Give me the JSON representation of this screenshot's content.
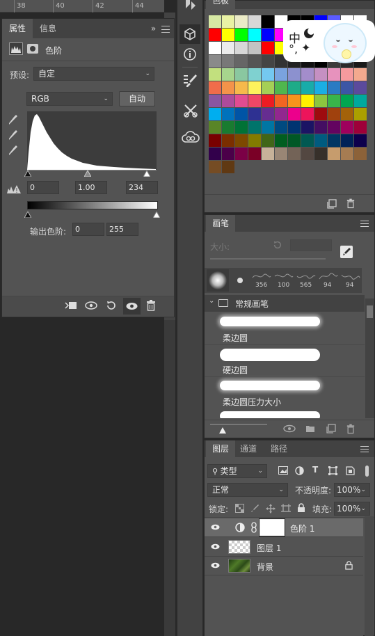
{
  "ruler": {
    "marks": [
      "38",
      "40",
      "42",
      "44"
    ]
  },
  "properties": {
    "tabs": [
      "属性",
      "信息"
    ],
    "layer_type": "色阶",
    "preset_label": "预设:",
    "preset_value": "自定",
    "channel": "RGB",
    "auto_label": "自动",
    "input_black": "0",
    "input_gamma": "1.00",
    "input_white": "234",
    "output_label": "输出色阶:",
    "output_black": "0",
    "output_white": "255"
  },
  "swatches": {
    "tab": "色板",
    "colors_rows": [
      [
        "#d7e9a4",
        "#e9f2a4",
        "#ebebc7",
        "#d7d7d7",
        "#000000",
        "#ffffff",
        "#000000",
        "#000000",
        "#0000ff",
        "#5b5bff",
        "#ffffff",
        "#ffffff"
      ],
      [
        "#ff0000",
        "#ffff00",
        "#00ff00",
        "#00ffff",
        "#0000ff",
        "#ff00ff",
        "#ffffff",
        "#ffffff",
        "#ffffff",
        "#ffffff",
        "#ffffff",
        "#ffffff"
      ],
      [
        "#ffffff",
        "#ebebeb",
        "#d7d7d7",
        "#c3c3c3",
        "#ff0000",
        "#ffff00",
        "#adadad",
        "#a4a4a4",
        "#8f8f8f",
        "#7b7b7b",
        "#666666",
        "#555555"
      ],
      [
        "#8a8a8a",
        "#787878",
        "#666666",
        "#555555",
        "#444444",
        "#333333",
        "#222222",
        "#111111",
        "#000000",
        "#3b3b3b",
        "#2a2a2a",
        "#1a1a1a"
      ],
      [
        "#c2e07e",
        "#a7d58d",
        "#8ac7a0",
        "#7fd1d0",
        "#74c8f0",
        "#7aa3df",
        "#8c91cf",
        "#a38dcb",
        "#c590c2",
        "#e792bd",
        "#f59a9e",
        "#f3a98e"
      ],
      [
        "#f06c4a",
        "#f4934a",
        "#f6b94b",
        "#fdf35c",
        "#a5cf56",
        "#4fb74e",
        "#1eab88",
        "#18aca9",
        "#1aaee4",
        "#2a7bc3",
        "#3c56a5",
        "#5b4a9c"
      ],
      [
        "#8a56a1",
        "#ad4b9b",
        "#e14c91",
        "#ef4766",
        "#ed1c24",
        "#f26522",
        "#f7941d",
        "#fff200",
        "#8dc63f",
        "#39b54a",
        "#00a651",
        "#00a99d"
      ],
      [
        "#00aeef",
        "#0072bc",
        "#0054a6",
        "#2e3192",
        "#662d91",
        "#92278f",
        "#ec008c",
        "#ed145b",
        "#9e0b0f",
        "#a0410d",
        "#a3620a",
        "#aba000"
      ],
      [
        "#598527",
        "#197b30",
        "#007236",
        "#00746b",
        "#0076a3",
        "#004a80",
        "#003471",
        "#1b1464",
        "#440e62",
        "#630460",
        "#9e005d",
        "#9e0039"
      ],
      [
        "#790000",
        "#7b2e00",
        "#7d4900",
        "#827b00",
        "#406618",
        "#005e20",
        "#005826",
        "#005952",
        "#005b7f",
        "#003663",
        "#002157",
        "#0d004c"
      ],
      [
        "#32004b",
        "#4b0049",
        "#7b0046",
        "#7a0026",
        "#c7b299",
        "#998675",
        "#736357",
        "#534741",
        "#37302a",
        "#c69c6d",
        "#a67c52",
        "#8c6239"
      ],
      [
        "#754c24",
        "#603913"
      ]
    ]
  },
  "brush": {
    "tab": "画笔",
    "size_label": "大小:",
    "tips": [
      "356",
      "100",
      "565",
      "94",
      "94"
    ],
    "group": "常规画笔",
    "presets": [
      "柔边圆",
      "硬边圆",
      "柔边圆压力大小"
    ]
  },
  "layers": {
    "tabs": [
      "图层",
      "通道",
      "路径"
    ],
    "filter_kind": "类型",
    "blend_mode": "正常",
    "opacity_label": "不透明度:",
    "opacity": "100%",
    "lock_label": "锁定:",
    "fill_label": "填充:",
    "fill": "100%",
    "rows": [
      {
        "name": "色阶 1"
      },
      {
        "name": "图层 1"
      },
      {
        "name": "背景"
      }
    ]
  },
  "ime": {
    "char": "中"
  }
}
